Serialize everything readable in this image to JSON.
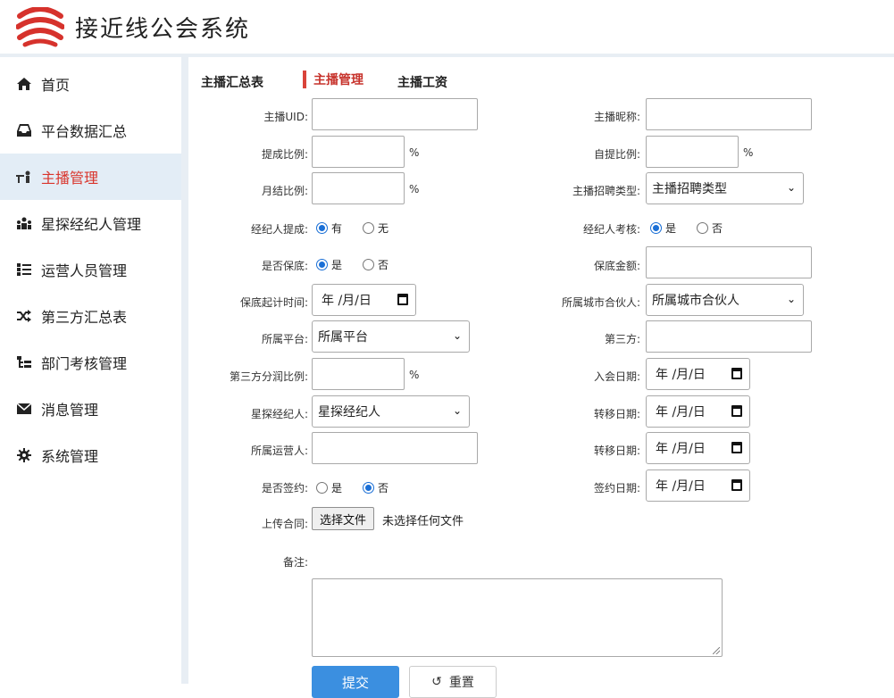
{
  "app": {
    "title": "接近线公会系统"
  },
  "sidebar": {
    "items": [
      {
        "label": "首页",
        "icon": "home-icon",
        "active": false
      },
      {
        "label": "平台数据汇总",
        "icon": "inbox-icon",
        "active": false
      },
      {
        "label": "主播管理",
        "icon": "broadcaster-icon",
        "active": true
      },
      {
        "label": "星探经纪人管理",
        "icon": "group-icon",
        "active": false
      },
      {
        "label": "运营人员管理",
        "icon": "list-icon",
        "active": false
      },
      {
        "label": "第三方汇总表",
        "icon": "shuffle-icon",
        "active": false
      },
      {
        "label": "部门考核管理",
        "icon": "hierarchy-icon",
        "active": false
      },
      {
        "label": "消息管理",
        "icon": "envelope-icon",
        "active": false
      },
      {
        "label": "系统管理",
        "icon": "gear-icon",
        "active": false
      }
    ]
  },
  "tabs": [
    {
      "label": "主播汇总表",
      "active": false
    },
    {
      "label": "主播管理",
      "active": true
    },
    {
      "label": "主播工资",
      "active": false
    }
  ],
  "form": {
    "anchor_uid_label": "主播UID:",
    "anchor_nickname_label": "主播昵称:",
    "commission_ratio_label": "提成比例:",
    "self_commission_label": "自提比例:",
    "monthly_ratio_label": "月结比例:",
    "recruit_type_label": "主播招聘类型:",
    "recruit_type_value": "主播招聘类型",
    "agent_commission_label": "经纪人提成:",
    "agent_commission_options": [
      "有",
      "无"
    ],
    "agent_review_label": "经纪人考核:",
    "agent_review_options": [
      "是",
      "否"
    ],
    "guarantee_label": "是否保底:",
    "guarantee_options": [
      "是",
      "否"
    ],
    "guarantee_amount_label": "保底金额:",
    "guarantee_start_label": "保底起计时间:",
    "city_partner_label": "所属城市合伙人:",
    "city_partner_value": "所属城市合伙人",
    "platform_label": "所属平台:",
    "platform_value": "所属平台",
    "third_party_label": "第三方:",
    "third_party_share_label": "第三方分润比例:",
    "join_date_label": "入会日期:",
    "scout_label": "星探经纪人:",
    "scout_value": "星探经纪人",
    "transfer_date_label": "转移日期:",
    "operator_label": "所属运营人:",
    "transfer_date2_label": "转移日期:",
    "signed_label": "是否签约:",
    "signed_options": [
      "是",
      "否"
    ],
    "sign_date_label": "签约日期:",
    "upload_label": "上传合同:",
    "file_button": "选择文件",
    "file_status": "未选择任何文件",
    "remark_label": "备注:",
    "percent": "%",
    "date_placeholder": "年 /月/日",
    "submit": "提交",
    "reset": "重置",
    "reset_icon_glyph": "↺"
  }
}
